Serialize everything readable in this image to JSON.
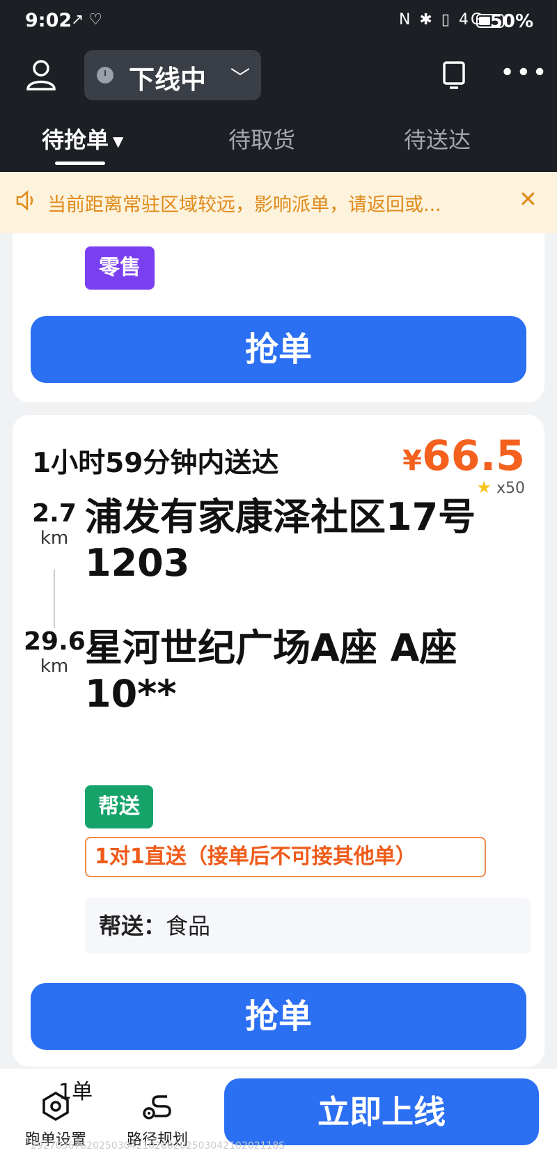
{
  "status_bar": {
    "time": "9:02",
    "extra": "↗ ♡",
    "icons": "N ✱ ▯ 4G",
    "battery_text": "50%",
    "battery_level": 0.5
  },
  "header": {
    "status_label": "下线中"
  },
  "tabs": [
    {
      "label": "待抢单"
    },
    {
      "label": "待取货"
    },
    {
      "label": "待送达"
    }
  ],
  "notice": {
    "text": "当前距离常驻区域较远，影响派单，请返回或..."
  },
  "card1": {
    "tag": "零售",
    "grab_label": "抢单"
  },
  "card2": {
    "deliver_time": "1小时59分钟内送达",
    "price_symbol": "¥",
    "price_value": "66.5",
    "bonus": "x50",
    "pickup": {
      "distance": "2.7",
      "unit": "km",
      "address": "浦发有家康泽社区17号1203"
    },
    "dropoff": {
      "distance": "29.6",
      "unit": "km",
      "address": "星河世纪广场A座 A座10**"
    },
    "tag": "帮送",
    "note": "1对1直送（接单后不可接其他单）",
    "goods_key": "帮送：",
    "goods_value": "食品",
    "grab_label": "抢单"
  },
  "bottom_bar": {
    "order_settings": "跑单设置",
    "order_count": "1单",
    "route_planning": "路径规划",
    "go_online": "立即上线",
    "order_code": "2927036762025030421020020250304210202118S"
  },
  "colors": {
    "primary": "#2b6ff3",
    "price": "#f4601e",
    "retail_tag": "#7a3ff0",
    "help_tag": "#15a36a",
    "notice_bg": "#fdf2dc",
    "notice_text": "#e08a1a"
  }
}
